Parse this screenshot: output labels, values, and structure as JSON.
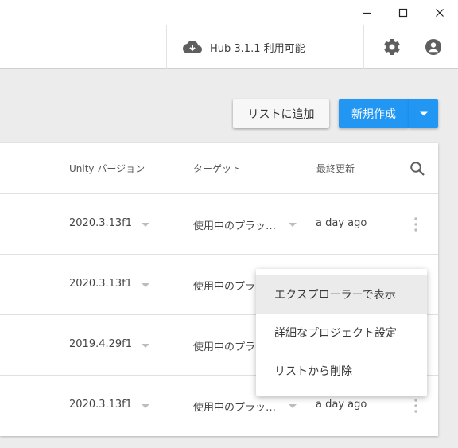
{
  "window": {
    "minimize_glyph": "—",
    "maximize_glyph": "☐",
    "close_glyph": "✕"
  },
  "topbar": {
    "hub_status": "Hub 3.1.1 利用可能",
    "icons": [
      "cloud-download-icon",
      "gear-icon",
      "account-icon"
    ]
  },
  "toolbar": {
    "add_list_label": "リストに追加",
    "new_label": "新規作成"
  },
  "table": {
    "headers": {
      "unity_version": "Unity バージョン",
      "target": "ターゲット",
      "last_modified": "最終更新"
    },
    "rows": [
      {
        "version": "2020.3.13f1",
        "target": "使用中のプラッ…",
        "modified": "a day ago"
      },
      {
        "version": "2020.3.13f1",
        "target": "使用中のプラ",
        "modified": ""
      },
      {
        "version": "2019.4.29f1",
        "target": "使用中のプラ",
        "modified": ""
      },
      {
        "version": "2020.3.13f1",
        "target": "使用中のプラッ…",
        "modified": "a day ago"
      }
    ]
  },
  "context_menu": {
    "items": [
      {
        "label": "エクスプローラーで表示"
      },
      {
        "label": "詳細なプロジェクト設定"
      },
      {
        "label": "リストから削除"
      }
    ]
  },
  "colors": {
    "accent": "#2196f3",
    "background": "#ececec",
    "menu_hover": "#ebebeb"
  }
}
